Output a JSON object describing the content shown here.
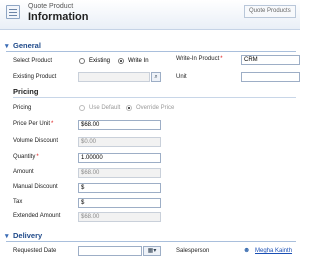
{
  "header": {
    "entity_name": "Quote Product",
    "form_title": "Information",
    "entity_selector": "Quote Products"
  },
  "sections": {
    "general": "General",
    "pricing": "Pricing",
    "delivery": "Delivery"
  },
  "general": {
    "select_product_label": "Select Product",
    "existing_label": "Existing",
    "write_in_label": "Write In",
    "write_in_selected": true,
    "write_in_product_label": "Write-In Product",
    "write_in_product_value": "CRM",
    "existing_product_label": "Existing Product",
    "existing_product_value": "",
    "unit_label": "Unit",
    "unit_value": ""
  },
  "pricing": {
    "pricing_label": "Pricing",
    "use_default_label": "Use Default",
    "override_price_label": "Override Price",
    "override_selected": true,
    "price_per_unit_label": "Price Per Unit",
    "price_per_unit_value": "$68.00",
    "volume_discount_label": "Volume Discount",
    "volume_discount_value": "$0.00",
    "quantity_label": "Quantity",
    "quantity_value": "1.00000",
    "amount_label": "Amount",
    "amount_value": "$68.00",
    "manual_discount_label": "Manual Discount",
    "manual_discount_value": "$",
    "tax_label": "Tax",
    "tax_value": "$",
    "extended_amount_label": "Extended Amount",
    "extended_amount_value": "$68.00"
  },
  "delivery": {
    "requested_date_label": "Requested Date",
    "requested_date_value": "",
    "salesperson_label": "Salesperson",
    "salesperson_value": "Megha Kainth"
  },
  "icons": {
    "lookup": "lookup-icon",
    "calendar": "calendar-icon",
    "user": "user-icon",
    "section_toggle": "chevron-down-icon"
  },
  "colors": {
    "section_title": "#1f4a8a",
    "required": "#dd1111",
    "link": "#1a4fb5"
  }
}
